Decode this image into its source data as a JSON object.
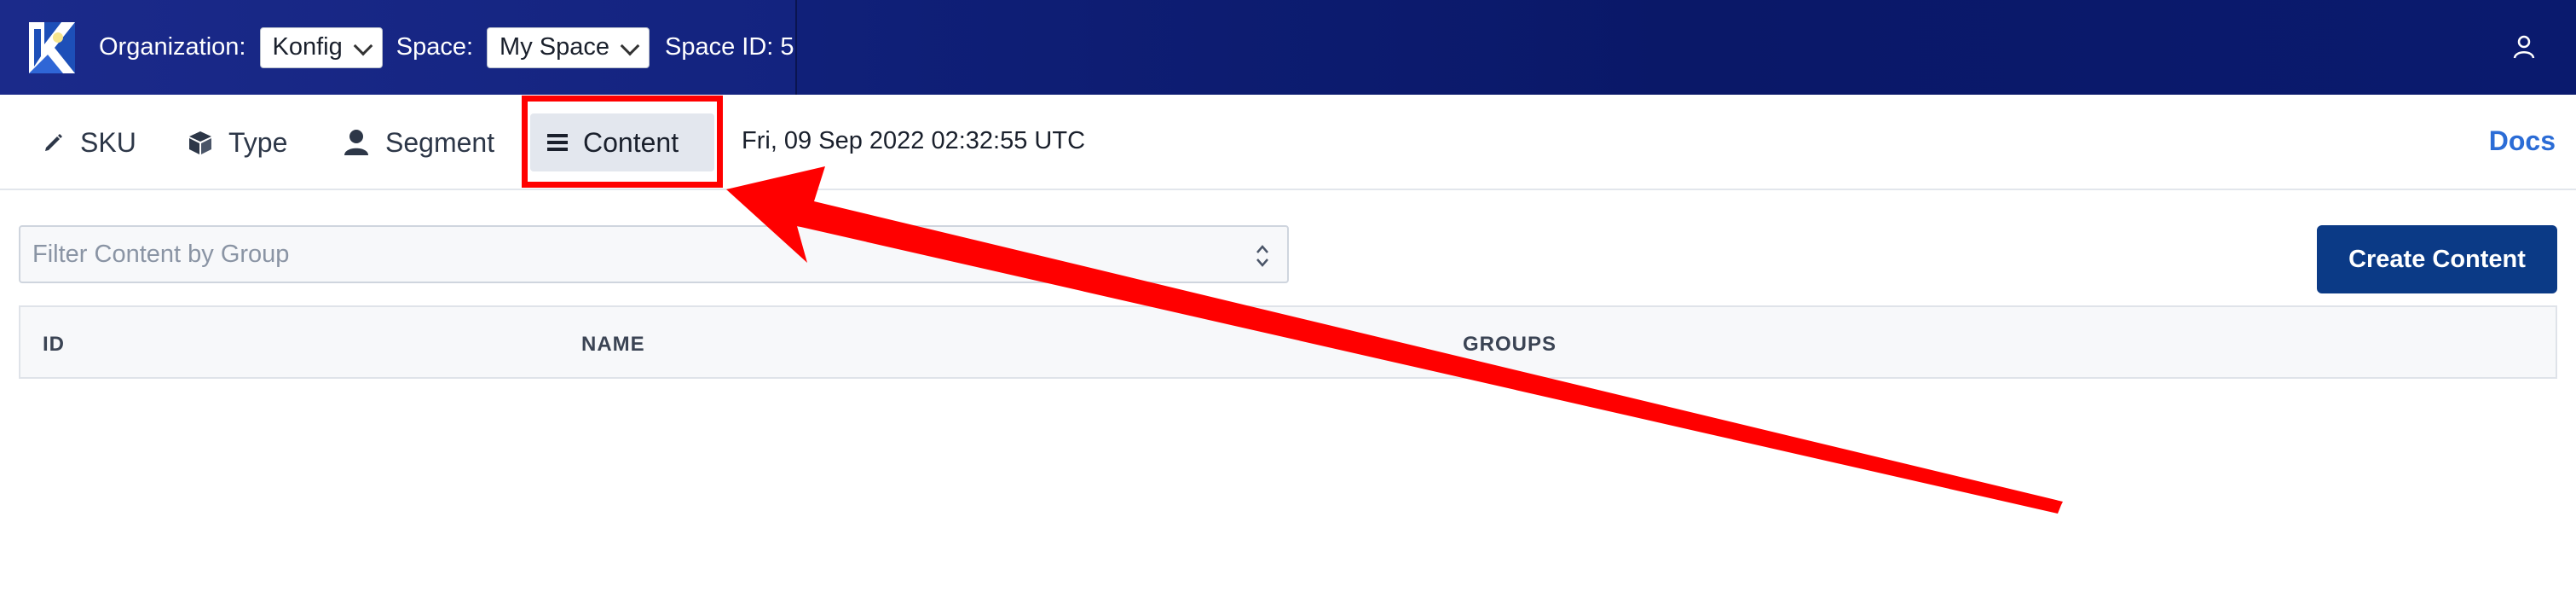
{
  "topbar": {
    "org_label": "Organization:",
    "org_value": "Konfig",
    "space_label": "Space:",
    "space_value": "My Space",
    "space_id": "Space ID: 5",
    "colors": {
      "background": "#0f1f77"
    }
  },
  "nav": {
    "items": [
      {
        "label": "SKU",
        "icon": "pencil-icon"
      },
      {
        "label": "Type",
        "icon": "cube-icon"
      },
      {
        "label": "Segment",
        "icon": "user-icon"
      },
      {
        "label": "Content",
        "icon": "list-icon",
        "active": true
      }
    ],
    "timestamp": "Fri, 09 Sep 2022 02:32:55 UTC",
    "docs_label": "Docs"
  },
  "toolbar": {
    "filter_placeholder": "Filter Content by Group",
    "create_label": "Create Content"
  },
  "table": {
    "columns": [
      "ID",
      "NAME",
      "GROUPS"
    ],
    "rows": []
  },
  "annotation": {
    "color": "#ff0000",
    "target": "Content"
  }
}
